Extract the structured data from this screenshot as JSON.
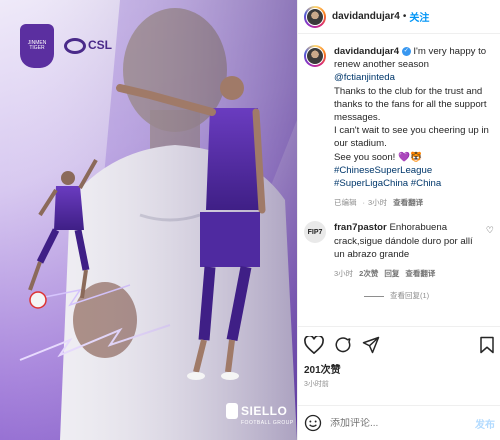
{
  "header": {
    "username": "davidandujar4",
    "separator": "•",
    "follow_label": "关注"
  },
  "caption": {
    "username": "davidandujar4",
    "verified_mark": "✓",
    "line1": "I'm very happy to renew another season",
    "mention": "@fctianjinteda",
    "line2": "Thanks to the club for the trust and thanks to the fans for all the support messages.",
    "line3": "I can't wait to see you cheering up in our stadium.",
    "line4": "See you soon! 💜🐯",
    "hashtags1": "#ChineseSuperLeague",
    "hashtags2": "#SuperLigaChina #China",
    "meta": {
      "edited": "已编辑",
      "sep": "·",
      "time": "3小时",
      "translate": "查看翻译"
    }
  },
  "comment": {
    "avatar_text": "FIP7",
    "username": "fran7pastor",
    "text": "Enhorabuena crack,sigue dándole duro por allí un abrazo grande",
    "meta": {
      "time": "3小时",
      "likes": "2次赞",
      "reply": "回复",
      "translate": "查看翻译"
    },
    "replies_label": "查看回复(1)"
  },
  "actions": {
    "likes": "201次赞",
    "time": "3小时前"
  },
  "composer": {
    "placeholder": "添加评论...",
    "post_label": "发布"
  },
  "media": {
    "badge_text": "JINMEN TIGER",
    "league_text": "CSL",
    "sponsor_name": "SIELLO",
    "sponsor_sub": "FOOTBALL GROUP"
  },
  "colors": {
    "accent": "#0095f6",
    "kit_purple": "#5b2fa0",
    "bg_purple": "#a784dc"
  }
}
